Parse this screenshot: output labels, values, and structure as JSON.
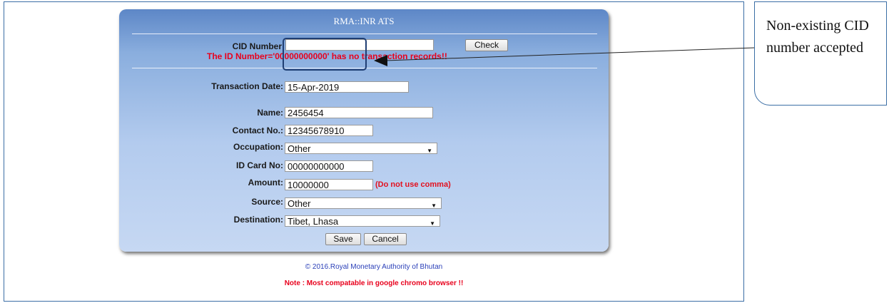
{
  "panel": {
    "title": "RMA::INR ATS"
  },
  "form": {
    "cid": {
      "label": "CID Number:",
      "value": "",
      "check_label": "Check"
    },
    "error_message": "The ID Number='00000000000' has no transaction records!!",
    "transaction_date": {
      "label": "Transaction Date:",
      "value": "15-Apr-2019"
    },
    "name": {
      "label": "Name:",
      "value": "2456454"
    },
    "contact": {
      "label": "Contact No.:",
      "value": "12345678910"
    },
    "occupation": {
      "label": "Occupation:",
      "value": "Other"
    },
    "id_card": {
      "label": "ID Card No:",
      "value": "00000000000"
    },
    "amount": {
      "label": "Amount:",
      "value": "10000000",
      "hint": "(Do not use comma)"
    },
    "source": {
      "label": "Source:",
      "value": "Other"
    },
    "destination": {
      "label": "Destination:",
      "value": "Tibet, Lhasa"
    },
    "save_label": "Save",
    "cancel_label": "Cancel"
  },
  "footer": {
    "copyright": "© 2016.Royal Monetary Authority of Bhutan",
    "note": "Note : Most compatable in google chromo browser !!"
  },
  "annotation": {
    "callout_text": "Non-existing CID number accepted",
    "icons": {
      "dropdown": "chevron-down-icon",
      "pointer": "arrow-left-icon"
    },
    "colors": {
      "error": "#e8001c",
      "footer_link": "#2a3fb8",
      "highlight": "#1f3e73"
    }
  }
}
